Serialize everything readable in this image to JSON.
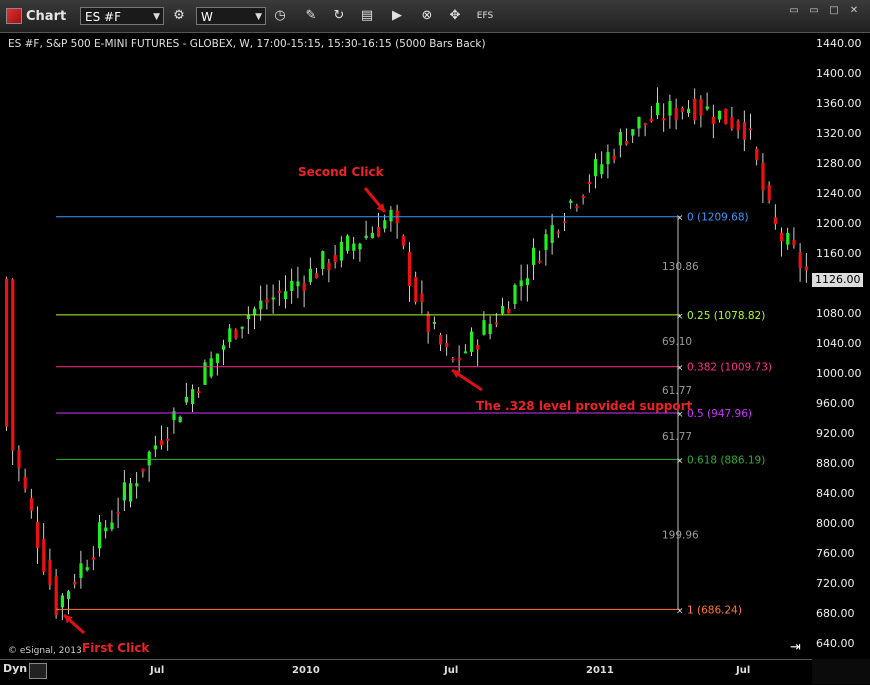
{
  "toolbar": {
    "window_title": "Chart",
    "symbol_value": "ES #F",
    "interval_value": "W",
    "efs_label": "EFS"
  },
  "chart": {
    "header": "ES #F, S&P 500 E-MINI FUTURES - GLOBEX, W, 17:00-15:15, 15:30-16:15 (5000 Bars Back)",
    "copyright": "© eSignal, 2013",
    "dyn_label": "Dyn",
    "last_price": "1126.00",
    "x_labels": [
      "Jul",
      "2010",
      "Jul",
      "2011",
      "Jul"
    ],
    "y_labels": [
      "1440.00",
      "1400.00",
      "1360.00",
      "1320.00",
      "1280.00",
      "1240.00",
      "1200.00",
      "1160.00",
      "1120.00",
      "1080.00",
      "1040.00",
      "1000.00",
      "960.00",
      "920.00",
      "880.00",
      "840.00",
      "800.00",
      "760.00",
      "720.00",
      "680.00",
      "640.00"
    ],
    "colors": {
      "up": "#22ee22",
      "down": "#ee1111",
      "background": "#000000"
    }
  },
  "fib": {
    "levels": [
      {
        "label": "0 (1209.68)",
        "color": "#3399ff"
      },
      {
        "label": "0.25 (1078.82)",
        "color": "#aaff33"
      },
      {
        "label": "0.382 (1009.73)",
        "color": "#ff2d87"
      },
      {
        "label": "0.5 (947.96)",
        "color": "#cc33ff"
      },
      {
        "label": "0.618 (886.19)",
        "color": "#33aa33"
      },
      {
        "label": "1 (686.24)",
        "color": "#ff7733"
      }
    ],
    "distances": [
      "130.86",
      "69.10",
      "61.77",
      "61.77",
      "199.96"
    ]
  },
  "annotations": {
    "second_click": "Second Click",
    "first_click": "First Click",
    "support_note": "The .328 level provided support"
  },
  "chart_data": {
    "type": "candlestick",
    "title": "ES #F, S&P 500 E-MINI FUTURES - GLOBEX, W, 17:00-15:15, 15:30-16:15 (5000 Bars Back)",
    "ylim": [
      640,
      1440
    ],
    "x_ticks": [
      "Jul",
      "2010",
      "Jul",
      "2011",
      "Jul"
    ],
    "fib_levels": [
      {
        "ratio": 0,
        "price": 1209.68
      },
      {
        "ratio": 0.25,
        "price": 1078.82
      },
      {
        "ratio": 0.382,
        "price": 1009.73
      },
      {
        "ratio": 0.5,
        "price": 947.96
      },
      {
        "ratio": 0.618,
        "price": 886.19
      },
      {
        "ratio": 1,
        "price": 686.24
      }
    ],
    "last_price": 1126.0
  }
}
